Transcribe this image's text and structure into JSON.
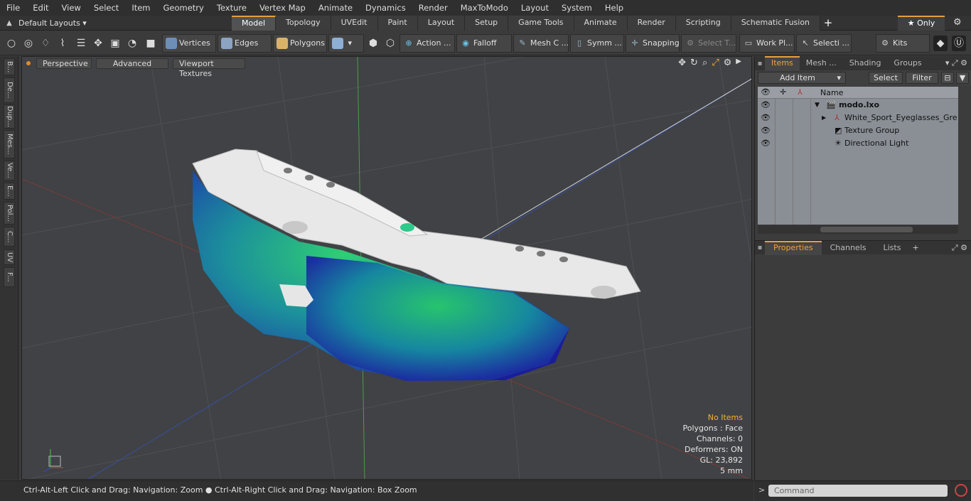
{
  "menu": [
    "File",
    "Edit",
    "View",
    "Select",
    "Item",
    "Geometry",
    "Texture",
    "Vertex Map",
    "Animate",
    "Dynamics",
    "Render",
    "MaxToModo",
    "Layout",
    "System",
    "Help"
  ],
  "layouts": {
    "label": "Default Layouts ▾"
  },
  "tabs": [
    "Model",
    "Topology",
    "UVEdit",
    "Paint",
    "Layout",
    "Setup",
    "Game Tools",
    "Animate",
    "Render",
    "Scripting",
    "Schematic Fusion"
  ],
  "only_label": "★ Only",
  "toolbar": {
    "vertices": "Vertices",
    "edges": "Edges",
    "polygons": "Polygons",
    "action": "Action ...",
    "falloff": "Falloff",
    "mesh": "Mesh C ...",
    "symm": "Symm ...",
    "snapping": "Snapping",
    "select_t": "Select T...",
    "workpl": "Work Pl...",
    "selecti": "Selecti ...",
    "kits": "Kits"
  },
  "left_tabs": [
    "B...",
    "De...",
    "Dup...",
    "Mes...",
    "Ve...",
    "E...",
    "Pol...",
    "C...",
    "UV",
    "F..."
  ],
  "viewport": {
    "perspective": "Perspective",
    "advanced": "Advanced",
    "textures": "Viewport Textures"
  },
  "info": {
    "items": "No Items",
    "polygons": "Polygons : Face",
    "channels": "Channels: 0",
    "deformers": "Deformers: ON",
    "gl": "GL: 23,892",
    "scale": "5 mm"
  },
  "status": "Ctrl-Alt-Left Click and Drag: Navigation: Zoom ● Ctrl-Alt-Right Click and Drag: Navigation: Box Zoom",
  "right_tabs": [
    "Items",
    "Mesh ...",
    "Shading",
    "Groups"
  ],
  "items_bar": {
    "add": "Add Item",
    "select": "Select",
    "filter": "Filter"
  },
  "tree": {
    "name_col": "Name",
    "root": "modo.lxo",
    "rows": [
      "White_Sport_Eyeglasses_Gre...",
      "Texture Group",
      "Directional Light"
    ]
  },
  "props_tabs": [
    "Properties",
    "Channels",
    "Lists"
  ],
  "command": {
    "placeholder": "Command"
  }
}
